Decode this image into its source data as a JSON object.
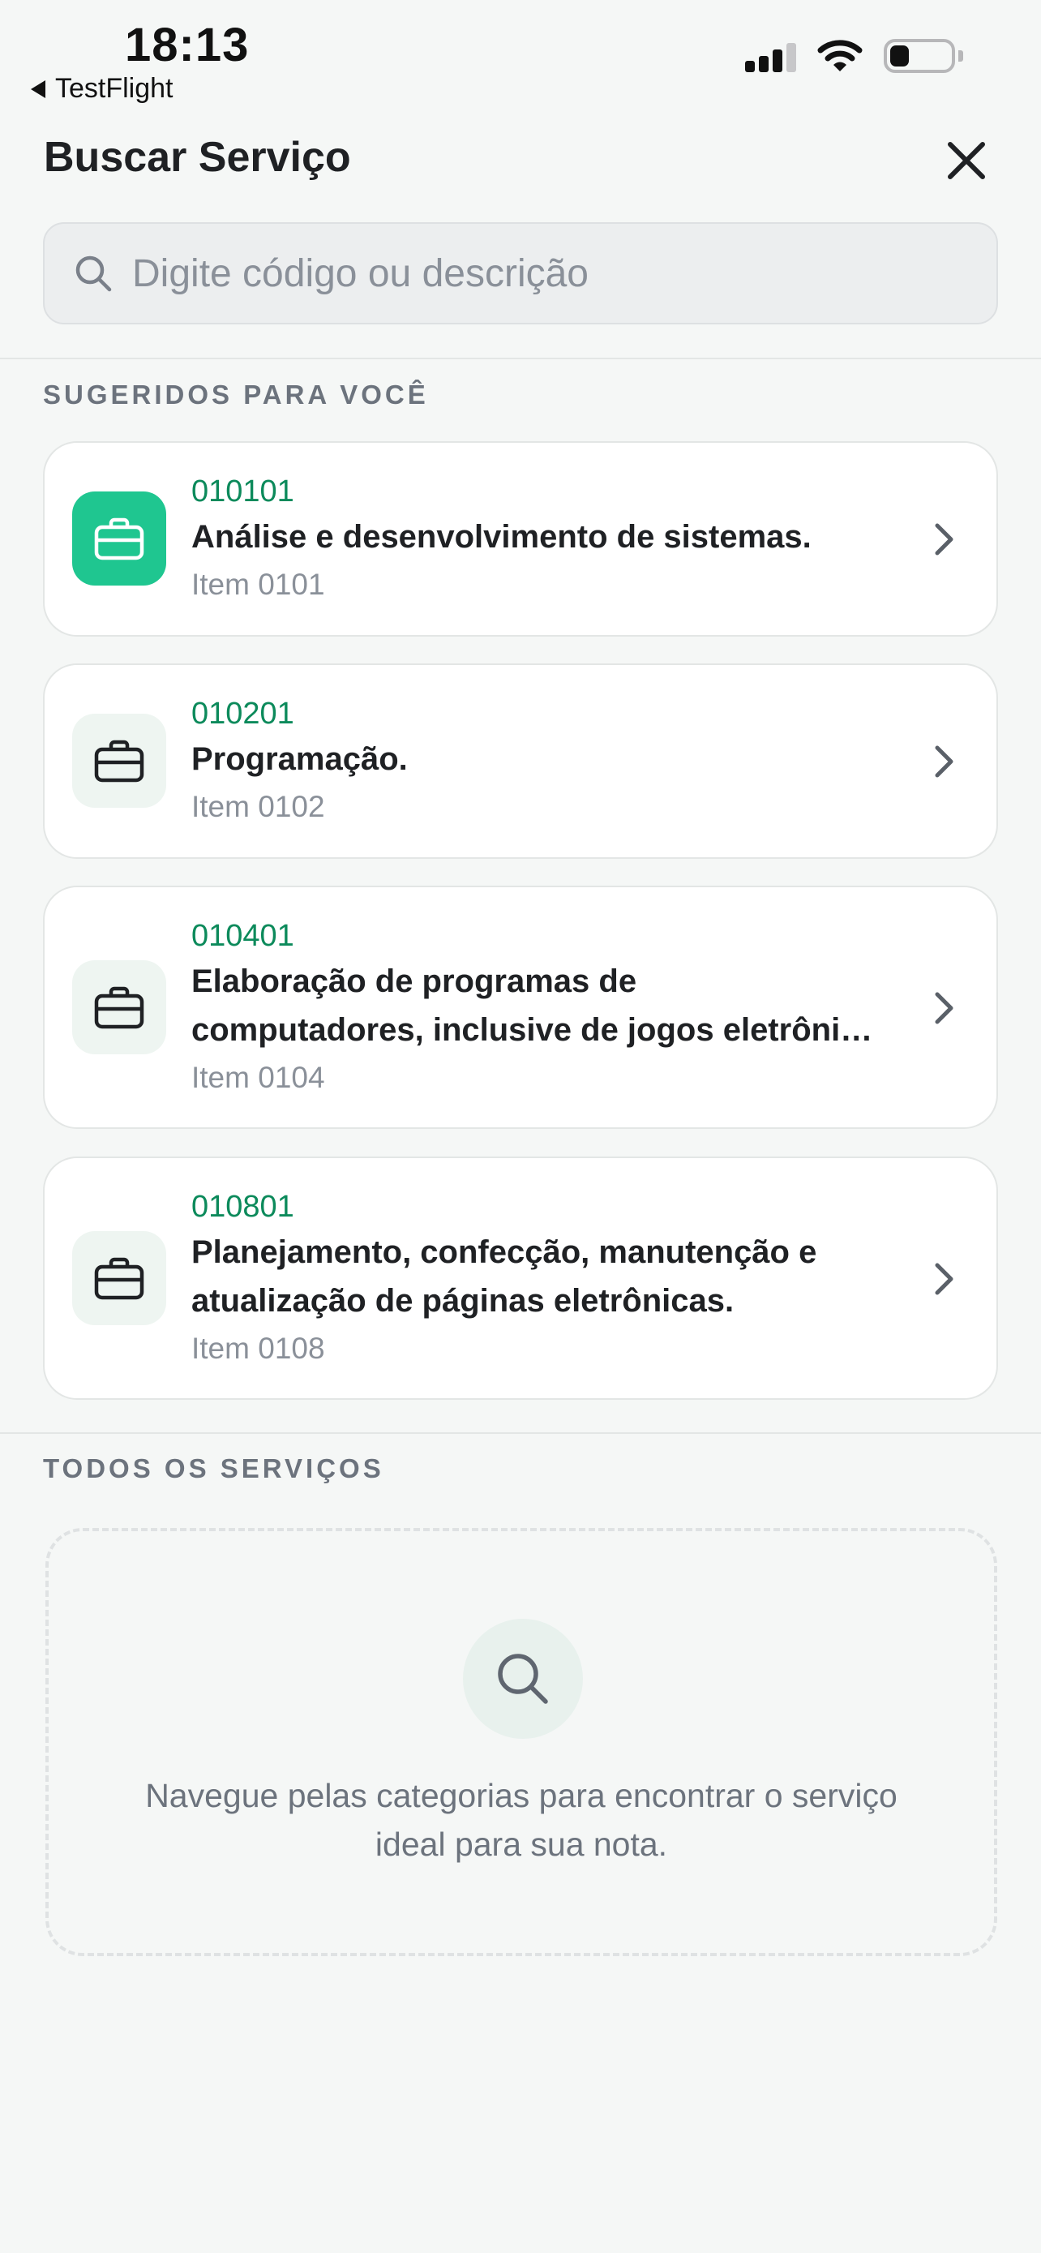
{
  "status_bar": {
    "time": "18:13",
    "back_app": "TestFlight"
  },
  "header": {
    "title": "Buscar Serviço",
    "search_placeholder": "Digite código ou descrição"
  },
  "suggested": {
    "section_label": "SUGERIDOS PARA VOCÊ",
    "items": [
      {
        "code": "010101",
        "title": "Análise e desenvolvimento de sistemas.",
        "subtitle": "Item 0101",
        "selected": true
      },
      {
        "code": "010201",
        "title": "Programação.",
        "subtitle": "Item 0102",
        "selected": false
      },
      {
        "code": "010401",
        "title_line1": "Elaboração de programas de",
        "title_line2": "computadores, inclusive de jogos eletrônicos,",
        "subtitle": "Item 0104",
        "selected": false
      },
      {
        "code": "010801",
        "title_line1": "Planejamento, confecção, manutenção e",
        "title_line2": "atualização de páginas eletrônicas.",
        "subtitle": "Item 0108",
        "selected": false
      }
    ]
  },
  "all_services": {
    "section_label": "TODOS OS SERVIÇOS",
    "empty_line1": "Navegue pelas categorias para encontrar o serviço",
    "empty_line2": "ideal para sua nota."
  },
  "colors": {
    "accent": "#1fc690",
    "code_text": "#0c8a5b",
    "background": "#f5f7f6"
  }
}
